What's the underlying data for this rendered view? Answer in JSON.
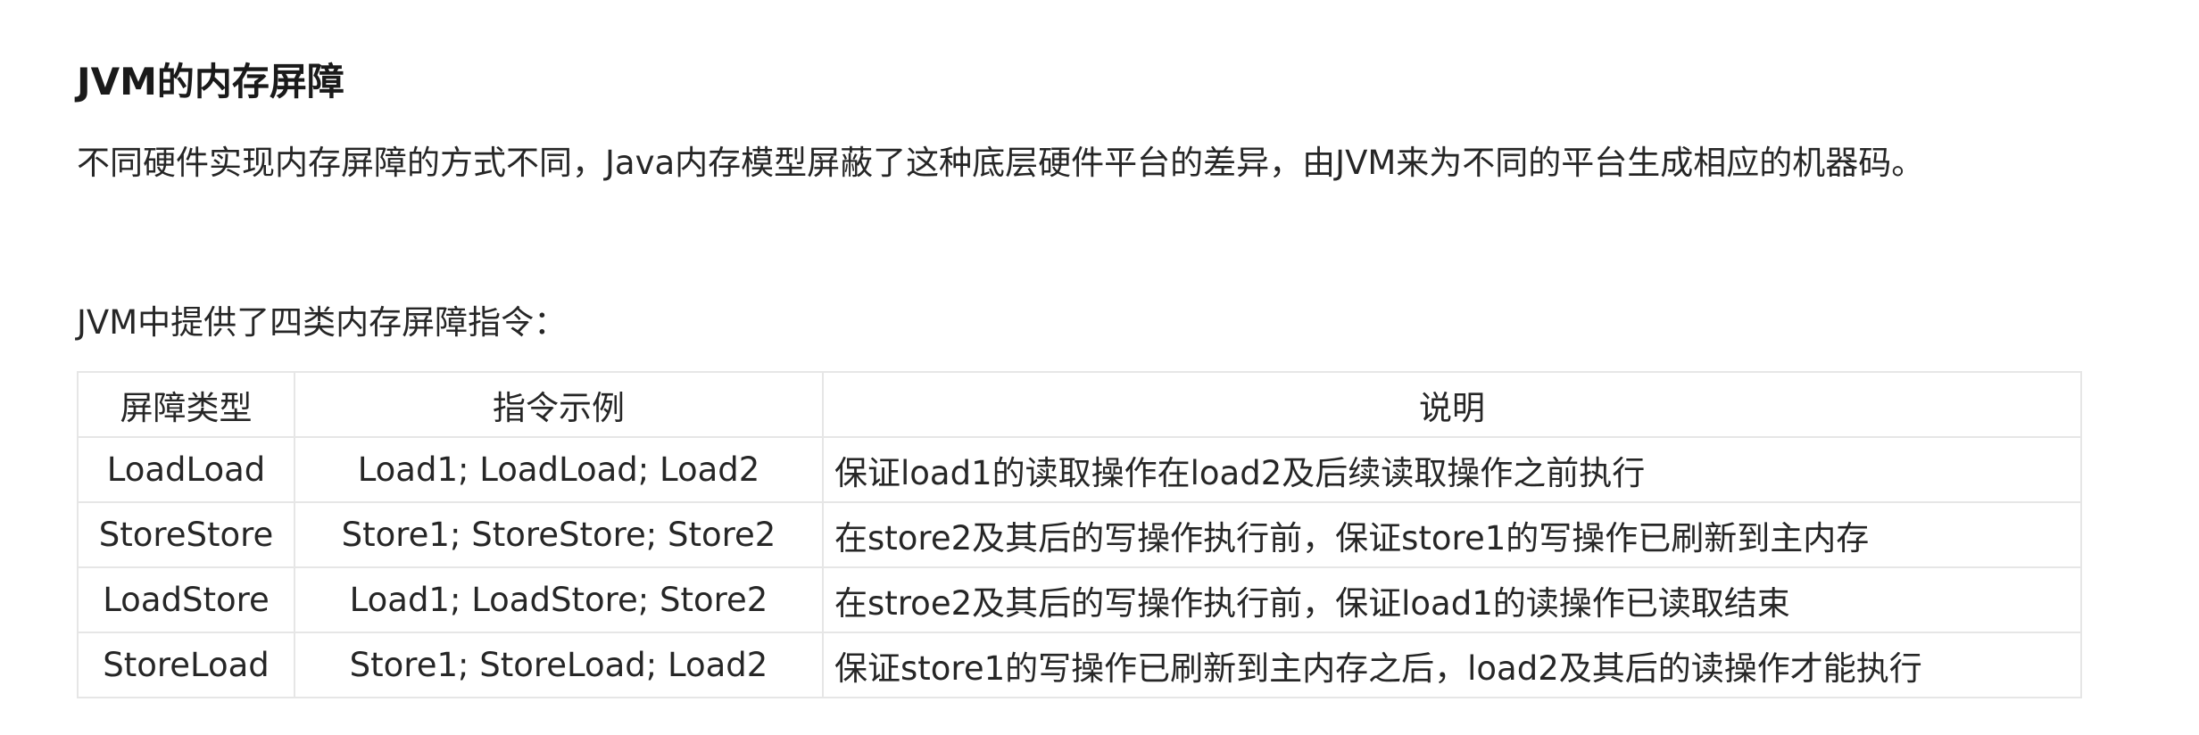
{
  "heading": "JVM的内存屏障",
  "paragraph": "不同硬件实现内存屏障的方式不同，Java内存模型屏蔽了这种底层硬件平台的差异，由JVM来为不同的平台生成相应的机器码。",
  "intro": "JVM中提供了四类内存屏障指令：",
  "table": {
    "headers": [
      "屏障类型",
      "指令示例",
      "说明"
    ],
    "rows": [
      [
        "LoadLoad",
        "Load1; LoadLoad; Load2",
        "保证load1的读取操作在load2及后续读取操作之前执行"
      ],
      [
        "StoreStore",
        "Store1; StoreStore; Store2",
        "在store2及其后的写操作执行前，保证store1的写操作已刷新到主内存"
      ],
      [
        "LoadStore",
        "Load1; LoadStore; Store2",
        "在stroe2及其后的写操作执行前，保证load1的读操作已读取结束"
      ],
      [
        "StoreLoad",
        "Store1; StoreLoad; Load2",
        "保证store1的写操作已刷新到主内存之后，load2及其后的读操作才能执行"
      ]
    ]
  }
}
